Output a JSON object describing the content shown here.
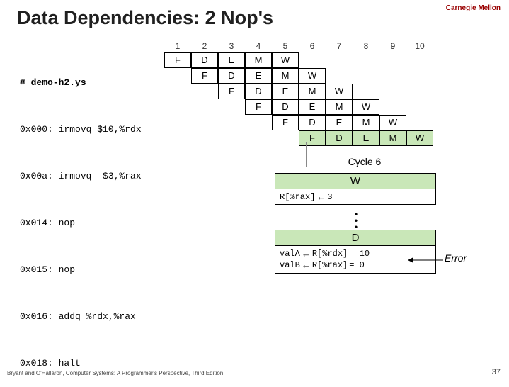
{
  "brand": "Carnegie Mellon",
  "title": "Data Dependencies: 2 Nop's",
  "code": {
    "header": "# demo-h2.ys",
    "lines": [
      "0x000: irmovq $10,%rdx",
      "0x00a: irmovq  $3,%rax",
      "0x014: nop",
      "0x015: nop",
      "0x016: addq %rdx,%rax",
      "0x018: halt"
    ]
  },
  "pipeline": {
    "cols": [
      "1",
      "2",
      "3",
      "4",
      "5",
      "6",
      "7",
      "8",
      "9",
      "10"
    ],
    "rows": [
      {
        "offset": 0,
        "stages": [
          "F",
          "D",
          "E",
          "M",
          "W"
        ],
        "highlight": false
      },
      {
        "offset": 1,
        "stages": [
          "F",
          "D",
          "E",
          "M",
          "W"
        ],
        "highlight": false
      },
      {
        "offset": 2,
        "stages": [
          "F",
          "D",
          "E",
          "M",
          "W"
        ],
        "highlight": false
      },
      {
        "offset": 3,
        "stages": [
          "F",
          "D",
          "E",
          "M",
          "W"
        ],
        "highlight": false
      },
      {
        "offset": 4,
        "stages": [
          "F",
          "D",
          "E",
          "M",
          "W"
        ],
        "highlight": false
      },
      {
        "offset": 5,
        "stages": [
          "F",
          "D",
          "E",
          "M",
          "W"
        ],
        "highlight": true
      }
    ]
  },
  "cycle_label": "Cycle 6",
  "w_head": "W",
  "w_body_left": "R[%rax]",
  "w_body_right": "3",
  "d_head": "D",
  "d_body": {
    "a_left": "valA",
    "a_mid": "R[%rdx]",
    "a_right": "= 10",
    "b_left": "valB",
    "b_mid": "R[%rax]",
    "b_right": "= 0"
  },
  "error_label": "Error",
  "footer": "Bryant and O'Hallaron, Computer Systems: A Programmer's Perspective, Third Edition",
  "page": "37"
}
